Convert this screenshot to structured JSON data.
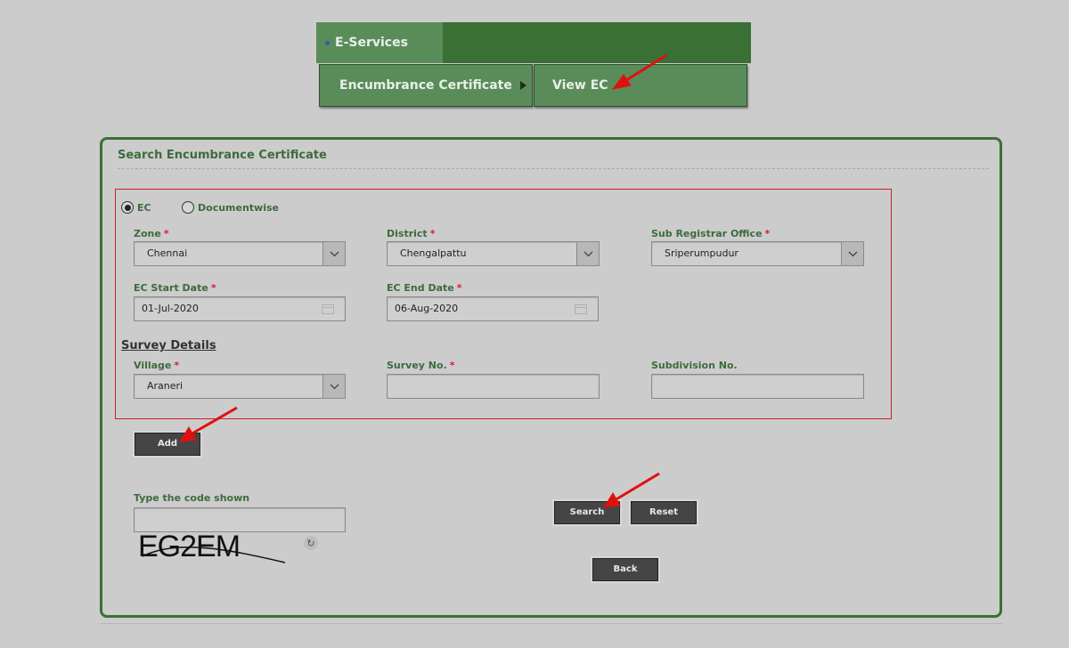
{
  "menu": {
    "top_item": "E-Services",
    "submenu_item": "Encumbrance Certificate",
    "submenu_child": "View EC"
  },
  "panel": {
    "title": "Search Encumbrance Certificate"
  },
  "search_type": {
    "options": [
      {
        "label": "EC",
        "selected": true
      },
      {
        "label": "Documentwise",
        "selected": false
      }
    ]
  },
  "fields": {
    "zone": {
      "label": "Zone",
      "required": "*",
      "value": "Chennai"
    },
    "district": {
      "label": "District",
      "required": "*",
      "value": "Chengalpattu"
    },
    "sro": {
      "label": "Sub Registrar Office",
      "required": "*",
      "value": "Sriperumpudur"
    },
    "ec_start": {
      "label": "EC Start Date",
      "required": "*",
      "value": "01-Jul-2020"
    },
    "ec_end": {
      "label": "EC End Date",
      "required": "*",
      "value": "06-Aug-2020"
    }
  },
  "survey": {
    "title": "Survey Details",
    "village": {
      "label": "Village",
      "required": "*",
      "value": "Araneri"
    },
    "survey_no": {
      "label": "Survey No.",
      "required": "*",
      "value": ""
    },
    "subdivision_no": {
      "label": "Subdivision No.",
      "value": ""
    }
  },
  "buttons": {
    "add": "Add",
    "search": "Search",
    "reset": "Reset",
    "back": "Back"
  },
  "captcha": {
    "label": "Type the code shown",
    "input_value": "",
    "code": "EG2EM",
    "refresh_icon": "refresh-icon"
  },
  "colors": {
    "menu_bg": "#3a7035",
    "menu_item_bg": "#5a8c5a",
    "label_green": "#3d6b3d",
    "required_red": "#d02040",
    "button_dark": "#454545",
    "highlight_red": "#cc2222"
  }
}
